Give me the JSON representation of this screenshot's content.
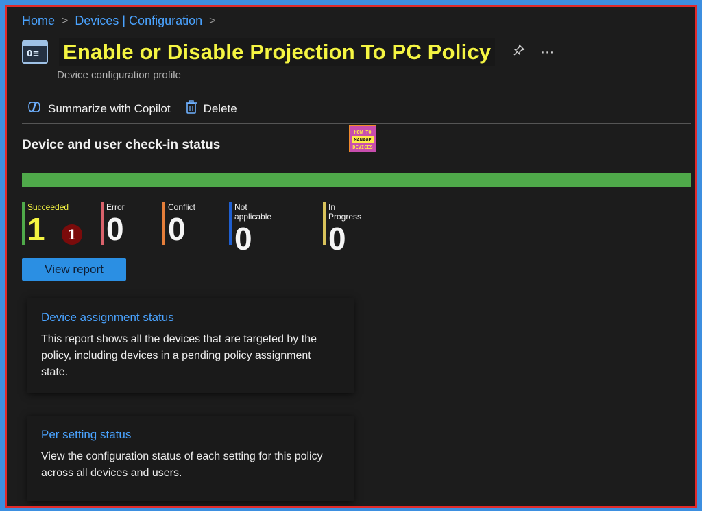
{
  "breadcrumb": {
    "items": [
      "Home",
      "Devices | Configuration"
    ],
    "sep": ">"
  },
  "header": {
    "title": "Enable or Disable Projection To PC Policy",
    "subtitle": "Device configuration profile",
    "title_icon": "profile-icon",
    "pin_icon": "pin-icon",
    "more_icon": "more-icon",
    "more_glyph": "···"
  },
  "toolbar": {
    "copilot_label": "Summarize with Copilot",
    "delete_label": "Delete"
  },
  "section": {
    "title": "Device and user check-in status"
  },
  "logo": {
    "line1": "HOW TO",
    "line2": "MANAGE",
    "line3": "DEVICES"
  },
  "statusBar": {
    "succeeded_fraction": 1.0,
    "color": "#4fa94a"
  },
  "stats": [
    {
      "label": "Succeeded",
      "value": "1",
      "color": "#4fa94a"
    },
    {
      "label": "Error",
      "value": "0",
      "color": "#d9626b"
    },
    {
      "label": "Conflict",
      "value": "0",
      "color": "#e57e3a"
    },
    {
      "label": "Not applicable",
      "value": "0",
      "color": "#1f5fd1"
    },
    {
      "label": "In Progress",
      "value": "0",
      "color": "#d8c25a"
    }
  ],
  "annotation": {
    "number": "1"
  },
  "actions": {
    "view_report": "View report"
  },
  "cards": [
    {
      "title": "Device assignment status",
      "body": "This report shows all the devices that are targeted by the policy, including devices in a pending policy assignment state."
    },
    {
      "title": "Per setting status",
      "body": "View the configuration status of each setting for this policy across all devices and users."
    }
  ],
  "colors": {
    "accent": "#4aa3ff",
    "highlight_title": "#f5f542",
    "frame_border": "#e02a2a",
    "button": "#2b8fe3"
  }
}
